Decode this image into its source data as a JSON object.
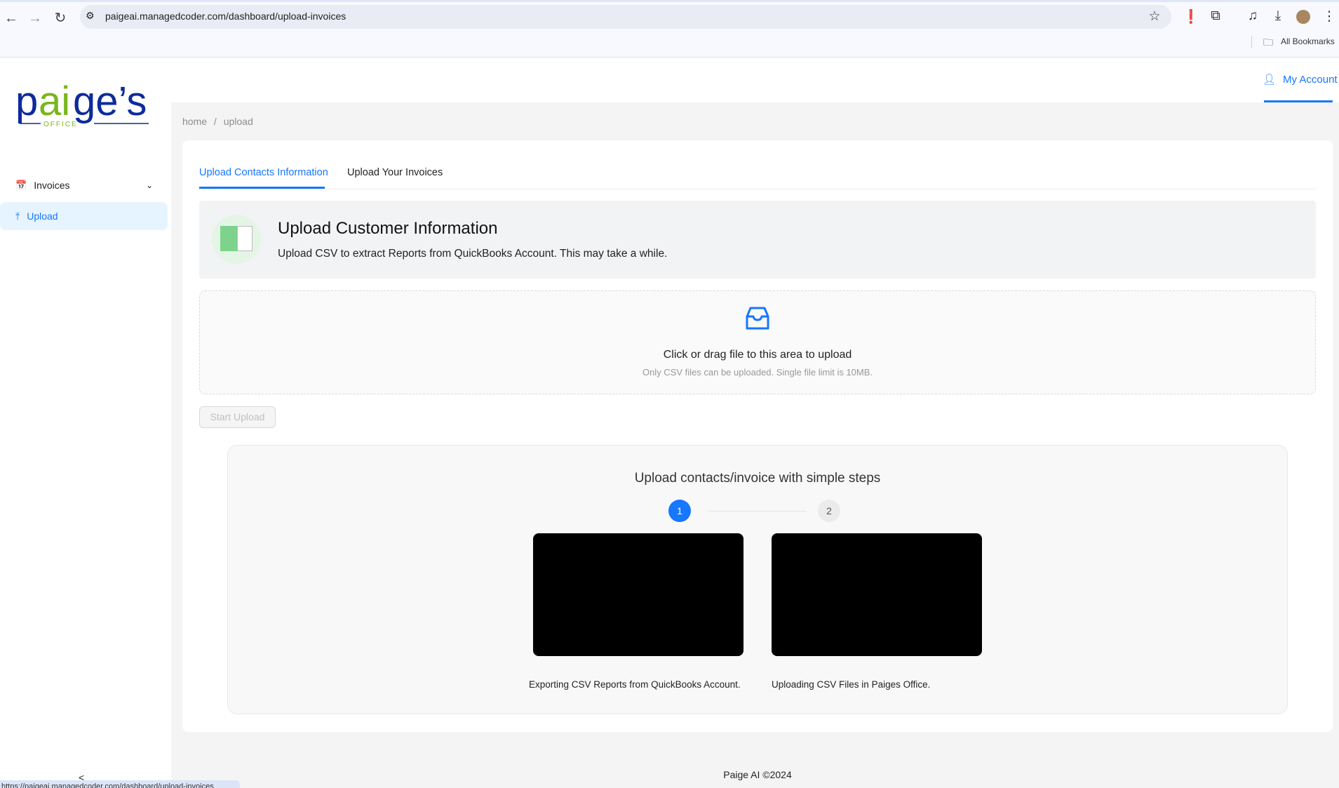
{
  "browser": {
    "url": "paigeai.managedcoder.com/dashboard/upload-invoices",
    "bookmarks_label": "All Bookmarks",
    "status_url": "https://paigeai.managedcoder.com/dashboard/upload-invoices"
  },
  "logo": {
    "text": "paige's",
    "subtext": "OFFICE"
  },
  "sidebar": {
    "items": [
      {
        "label": "Invoices",
        "icon": "calendar-icon"
      },
      {
        "label": "Upload",
        "icon": "upload-icon"
      }
    ],
    "collapse": "<"
  },
  "header": {
    "account_label": "My Account"
  },
  "breadcrumb": {
    "home": "home",
    "sep": "/",
    "current": "upload"
  },
  "tabs": [
    {
      "label": "Upload Contacts Information",
      "active": true
    },
    {
      "label": "Upload Your Invoices",
      "active": false
    }
  ],
  "info": {
    "title": "Upload Customer Information",
    "description": "Upload CSV to extract Reports from QuickBooks Account. This may take a while."
  },
  "dropzone": {
    "text": "Click or drag file to this area to upload",
    "hint": "Only CSV files can be uploaded. Single file limit is 10MB."
  },
  "start_button": "Start Upload",
  "steps": {
    "title": "Upload contacts/invoice with simple steps",
    "items": [
      {
        "number": "1",
        "caption": "Exporting CSV Reports from QuickBooks Account."
      },
      {
        "number": "2",
        "caption": "Uploading CSV Files in Paiges Office."
      }
    ],
    "current": 1
  },
  "footer": "Paige AI ©2024",
  "colors": {
    "primary": "#1677ff",
    "logo_blue": "#0d2b9a",
    "logo_green": "#7ab51d"
  }
}
